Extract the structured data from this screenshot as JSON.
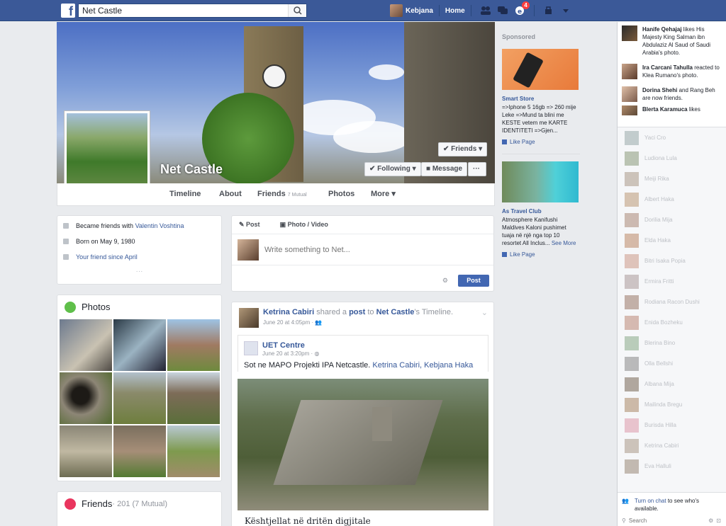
{
  "topbar": {
    "logo": "f",
    "search_value": "Net Castle",
    "user_name": "Kebjana",
    "home_label": "Home",
    "notification_count": "4"
  },
  "profile": {
    "name": "Net Castle",
    "buttons": {
      "friends": "Friends",
      "following": "Following",
      "message": "Message",
      "more": "···"
    },
    "tabs": [
      {
        "label": "Timeline"
      },
      {
        "label": "About"
      },
      {
        "label": "Friends",
        "sub": "7 Mutual"
      },
      {
        "label": "Photos"
      },
      {
        "label": "More"
      }
    ]
  },
  "intro": {
    "friends_prefix": "Became friends with ",
    "friends_name": "Valentin Voshtina",
    "born": "Born on May 9, 1980",
    "friend_since": "Your friend since April",
    "more": "···"
  },
  "photos": {
    "title": "Photos"
  },
  "friends_card": {
    "title": "Friends",
    "count": " · 201 (7 Mutual)"
  },
  "composer": {
    "tab_post": "Post",
    "tab_photo": "Photo / Video",
    "placeholder": "Write something to Net...",
    "post_button": "Post"
  },
  "story": {
    "author": "Ketrina Cabiri",
    "verb": " shared a ",
    "post_link": "post",
    "to": " to ",
    "target": "Net Castle",
    "suffix": "'s Timeline.",
    "time": "June 20 at 4:05pm",
    "shared_author": "UET Centre",
    "shared_time": "June 20 at 3:20pm",
    "shared_text": "Sot ne MAPO Projekti IPA Netcastle. ",
    "tagged": "Ketrina Cabiri, Kebjana Haka",
    "caption": "Kështjellat në dritën digjitale"
  },
  "ads": {
    "header": "Sponsored",
    "items": [
      {
        "title": "Smart Store",
        "text": "=>Iphone 5 16gb => 260 mije Leke =>Mund ta blini me KESTE vetem me KARTE IDENTITETI =>Gjen...",
        "like": "Like Page"
      },
      {
        "title": "As Travel Club",
        "text": "Atmosphere Kanifushi Maldives Kaloni pushimet tuaja në një nga top 10 resortet All Inclus... ",
        "see_more": "See More",
        "like": "Like Page"
      }
    ]
  },
  "ticker": [
    {
      "name": "Hanife Qehajaj",
      "text": " likes His Majesty King Salman ibn Abdulaziz Al Saud of Saudi Arabia's photo."
    },
    {
      "name": "Ira Carcani Tahulla",
      "text": " reacted to Klea Rumano's photo."
    },
    {
      "name": "Dorina Shehi",
      "text": " and Rang Beh are now friends."
    },
    {
      "name": "Blerta Karamuca",
      "text": " likes"
    }
  ],
  "buddies": [
    "Yaci Cro",
    "Ludiona Lula",
    "Meiji Rika",
    "Albert Haka",
    "Dorilia Mija",
    "Elda Haka",
    "Bitri Isaka Popia",
    "Ermira Fritti",
    "Rodiana Racon Dushi",
    "Enida Bozheku",
    "Blerina Bino",
    "Olla Bellshi",
    "Albana Mija",
    "Mailinda Bregu",
    "Burisda Hilla",
    "Ketrina Cabiri",
    "Eva Halluli"
  ],
  "chat": {
    "turn_on": "Turn on chat",
    "turn_on_rest": " to see who's available.",
    "search_placeholder": "Search"
  }
}
